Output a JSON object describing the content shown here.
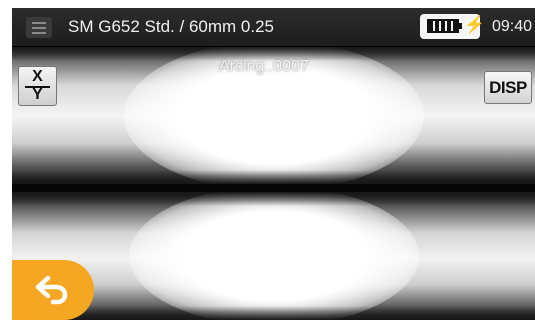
{
  "header": {
    "profile": "SM G652 Std. / 60mm 0.25",
    "clock": "09:40"
  },
  "status": {
    "message": "Arcing..0007"
  },
  "controls": {
    "xy_top": "X",
    "xy_bottom": "Y",
    "disp_label": "DISP"
  },
  "icons": {
    "menu": "hamburger-menu-icon",
    "battery": "battery-full-icon",
    "charging": "lightning-bolt-icon",
    "back": "back-arrow-icon"
  },
  "colors": {
    "accent": "#f5a623",
    "bar": "#1d1d1d"
  }
}
